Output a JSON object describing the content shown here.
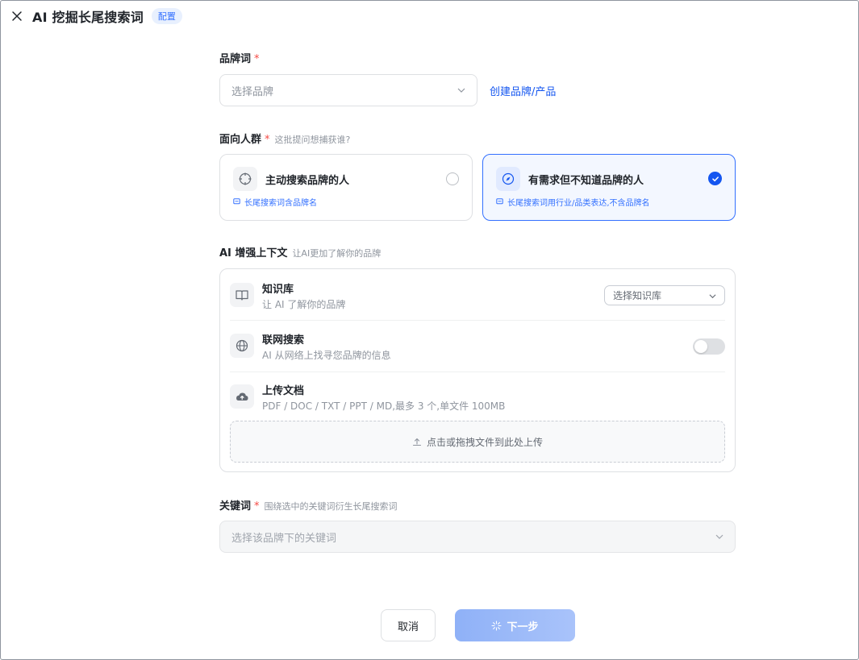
{
  "header": {
    "title": "AI 挖掘长尾搜索词",
    "badge": "配置"
  },
  "brand": {
    "label": "品牌词",
    "required_mark": "*",
    "placeholder": "选择品牌",
    "create_link": "创建品牌/产品"
  },
  "audience": {
    "label": "面向人群",
    "required_mark": "*",
    "hint": "这批提问想捕获谁?",
    "options": [
      {
        "title": "主动搜索品牌的人",
        "desc": "长尾搜索词含品牌名",
        "selected": false
      },
      {
        "title": "有需求但不知道品牌的人",
        "desc": "长尾搜索词用行业/品类表达,不含品牌名",
        "selected": true
      }
    ]
  },
  "ai_context": {
    "label": "AI 增强上下文",
    "hint": "让AI更加了解你的品牌",
    "knowledge": {
      "title": "知识库",
      "desc": "让 AI 了解你的品牌",
      "select_placeholder": "选择知识库"
    },
    "web_search": {
      "title": "联网搜索",
      "desc": "AI 从网络上找寻您品牌的信息",
      "enabled": false
    },
    "upload": {
      "title": "上传文档",
      "desc": "PDF / DOC / TXT / PPT / MD,最多 3 个,单文件 100MB",
      "dropzone": "点击或拖拽文件到此处上传"
    }
  },
  "keywords": {
    "label": "关键词",
    "required_mark": "*",
    "hint": "围绕选中的关键词衍生长尾搜索词",
    "placeholder": "选择该品牌下的关键词"
  },
  "footer": {
    "cancel": "取消",
    "next": "下一步"
  },
  "colors": {
    "primary": "#1456f0",
    "required": "#f54a45",
    "border": "#dee0e3"
  }
}
